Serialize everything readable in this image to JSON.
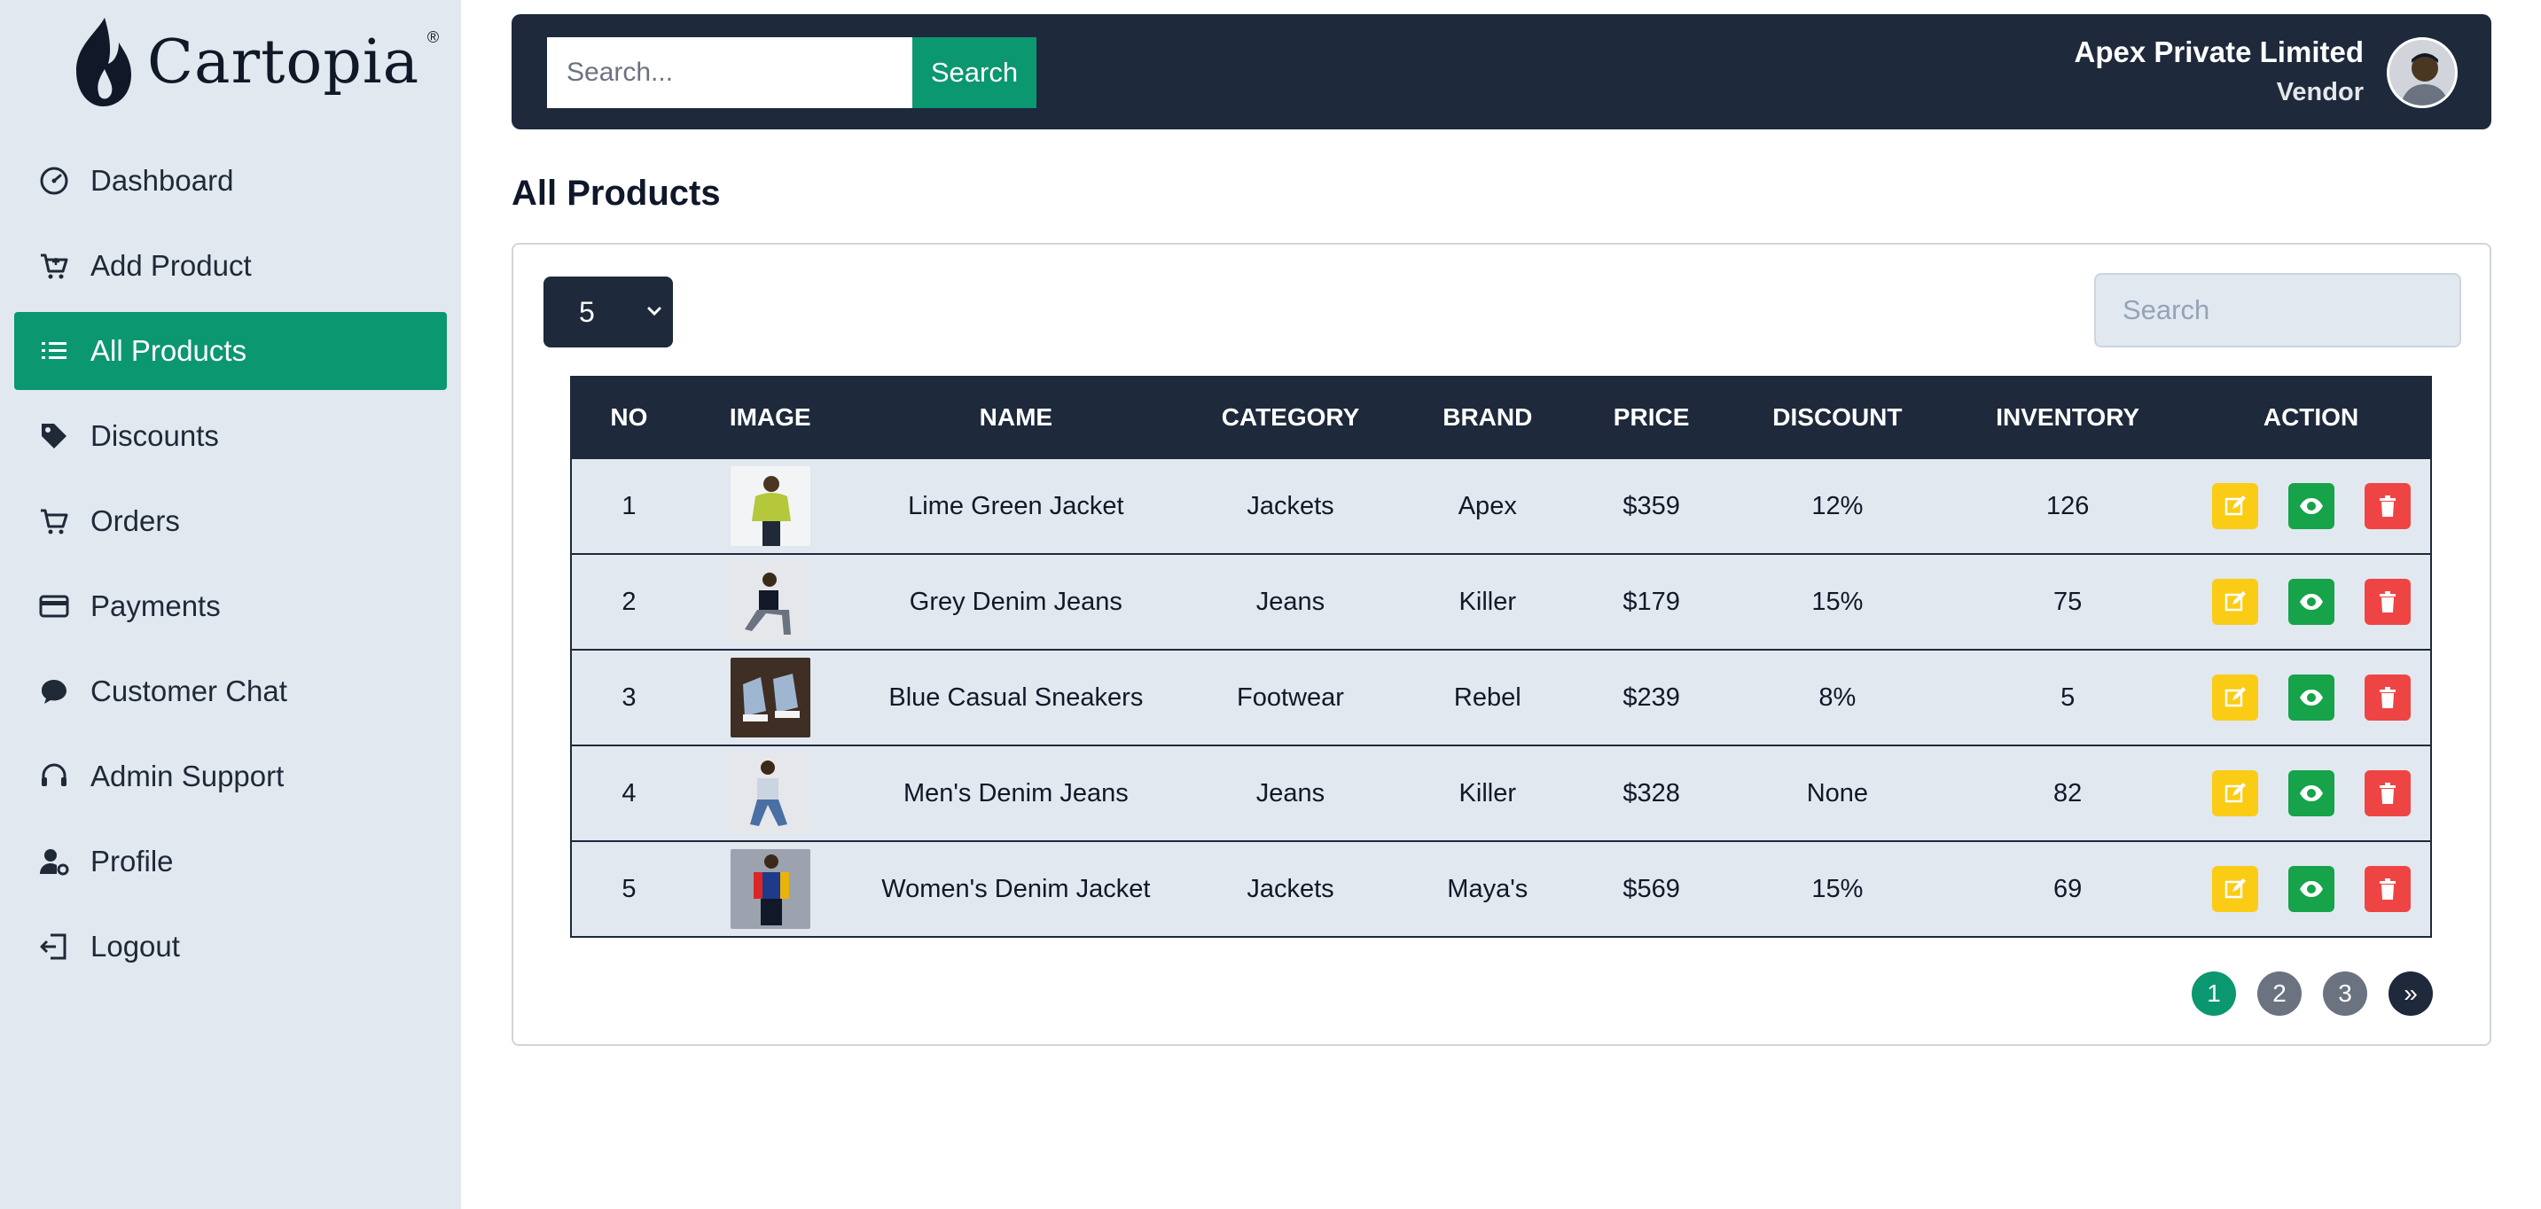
{
  "app": {
    "name": "Cartopia",
    "registered_mark": "®"
  },
  "sidebar": {
    "items": [
      {
        "label": "Dashboard",
        "icon": "gauge-icon",
        "active": false
      },
      {
        "label": "Add Product",
        "icon": "cart-plus-icon",
        "active": false
      },
      {
        "label": "All Products",
        "icon": "list-icon",
        "active": true
      },
      {
        "label": "Discounts",
        "icon": "tag-icon",
        "active": false
      },
      {
        "label": "Orders",
        "icon": "cart-icon",
        "active": false
      },
      {
        "label": "Payments",
        "icon": "credit-card-icon",
        "active": false
      },
      {
        "label": "Customer Chat",
        "icon": "chat-icon",
        "active": false
      },
      {
        "label": "Admin Support",
        "icon": "headset-icon",
        "active": false
      },
      {
        "label": "Profile",
        "icon": "user-gear-icon",
        "active": false
      },
      {
        "label": "Logout",
        "icon": "logout-icon",
        "active": false
      }
    ]
  },
  "header": {
    "search_placeholder": "Search...",
    "search_button": "Search",
    "user_name": "Apex Private Limited",
    "user_role": "Vendor"
  },
  "main": {
    "title": "All Products",
    "page_size": "5",
    "table_search_placeholder": "Search",
    "columns": [
      "NO",
      "IMAGE",
      "NAME",
      "CATEGORY",
      "BRAND",
      "PRICE",
      "DISCOUNT",
      "INVENTORY",
      "ACTION"
    ],
    "rows": [
      {
        "no": "1",
        "name": "Lime Green Jacket",
        "category": "Jackets",
        "brand": "Apex",
        "price": "$359",
        "discount": "12%",
        "inventory": "126"
      },
      {
        "no": "2",
        "name": "Grey Denim Jeans",
        "category": "Jeans",
        "brand": "Killer",
        "price": "$179",
        "discount": "15%",
        "inventory": "75"
      },
      {
        "no": "3",
        "name": "Blue Casual Sneakers",
        "category": "Footwear",
        "brand": "Rebel",
        "price": "$239",
        "discount": "8%",
        "inventory": "5"
      },
      {
        "no": "4",
        "name": "Men's Denim Jeans",
        "category": "Jeans",
        "brand": "Killer",
        "price": "$328",
        "discount": "None",
        "inventory": "82"
      },
      {
        "no": "5",
        "name": "Women's Denim Jacket",
        "category": "Jackets",
        "brand": "Maya's",
        "price": "$569",
        "discount": "15%",
        "inventory": "69"
      }
    ],
    "pagination": {
      "pages": [
        "1",
        "2",
        "3"
      ],
      "current": "1",
      "next_symbol": "»"
    }
  },
  "colors": {
    "accent": "#0b9770",
    "dark": "#1e293b",
    "sidebar_bg": "#e2e8f0",
    "edit": "#facc15",
    "view": "#16a34a",
    "delete": "#ef4444"
  }
}
